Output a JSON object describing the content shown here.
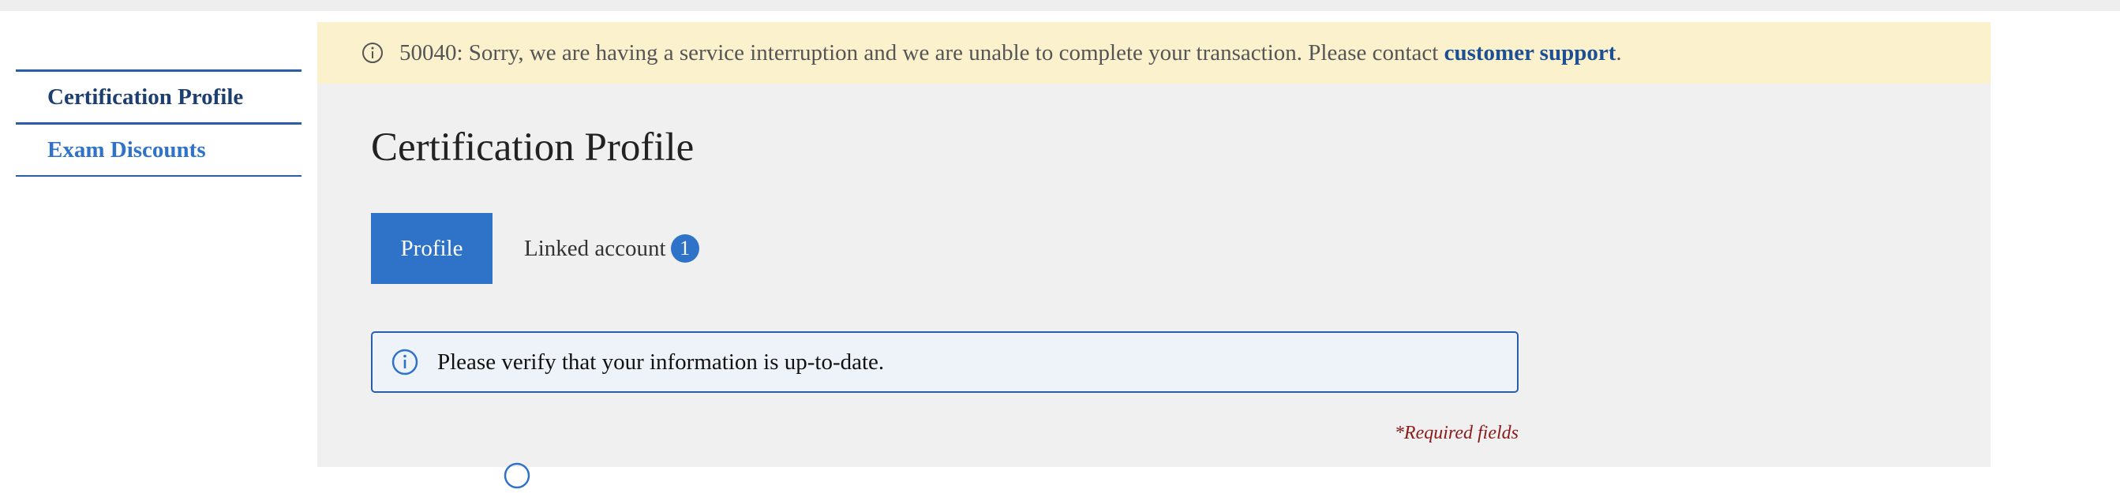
{
  "alert": {
    "icon": "info-circle-icon",
    "message": "50040: Sorry, we are having a service interruption and we are unable to complete your transaction. Please contact ",
    "link": "customer support",
    "suffix": "."
  },
  "sidebar": {
    "items": [
      {
        "label": "Certification Profile",
        "active": true
      },
      {
        "label": "Exam Discounts",
        "active": false
      }
    ]
  },
  "page": {
    "title": "Certification Profile"
  },
  "tabs": {
    "profile": "Profile",
    "linked": "Linked account",
    "linked_count": "1"
  },
  "info": {
    "icon": "info-circle-icon",
    "message": "Please verify that your information is up-to-date."
  },
  "form": {
    "required_note": "*Required fields"
  },
  "colors": {
    "primary": "#2f73c9",
    "dark_blue": "#1c3f70",
    "alert_bg": "#fbf2cd",
    "panel_bg": "#f0f0f0",
    "required": "#8b1a1a"
  }
}
